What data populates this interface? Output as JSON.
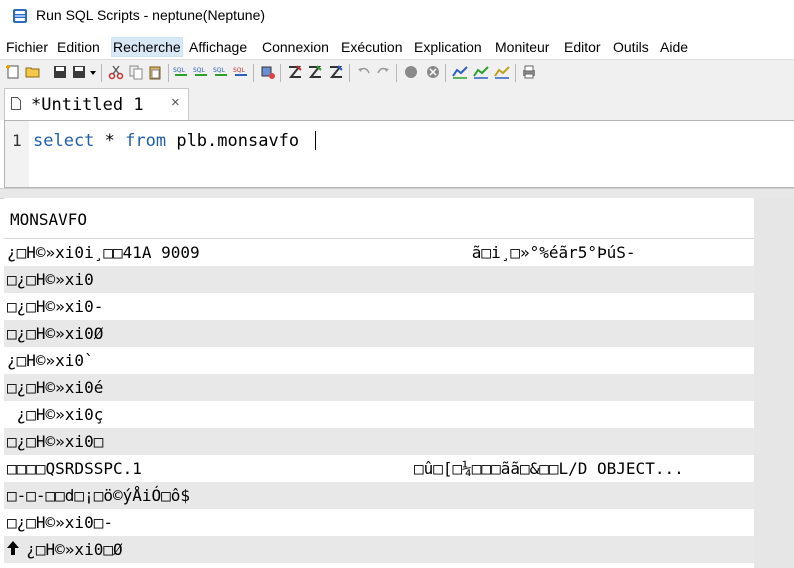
{
  "window": {
    "title": "Run SQL Scripts - neptune(Neptune)"
  },
  "menu": [
    {
      "label": "Fichier"
    },
    {
      "label": "Edition"
    },
    {
      "label": "Recherche",
      "active": true
    },
    {
      "label": "Affichage"
    },
    {
      "label": "Connexion"
    },
    {
      "label": "Exécution"
    },
    {
      "label": "Explication"
    },
    {
      "label": "Moniteur"
    },
    {
      "label": "Editor"
    },
    {
      "label": "Outils"
    },
    {
      "label": "Aide"
    }
  ],
  "toolbar": {
    "buttons": [
      "new-script-icon",
      "open-icon",
      "save-icon",
      "save-dropdown-icon",
      "cut-icon",
      "copy-icon",
      "paste-icon",
      "sql-statement-icon",
      "sql-selected-icon",
      "sql-all-icon",
      "sql-from-cursor-icon",
      "connection-icon",
      "explain-icon",
      "explain-run-icon",
      "explain-stop-icon",
      "undo-icon",
      "redo-icon",
      "stop-icon",
      "cancel-icon",
      "monitor-icon",
      "monitor-run-icon",
      "monitor-stop-icon",
      "print-icon"
    ]
  },
  "tab": {
    "label": "*Untitled 1",
    "close": "×"
  },
  "editor": {
    "line_number": "1",
    "kw_select": "select",
    "star": " * ",
    "kw_from": "from",
    "rest": " plb.monsavfo "
  },
  "results": {
    "column_header": "MONSAVFO",
    "rows": [
      {
        "left": "¿□H©»xi0i¸□□41A 9009",
        "right": "      ã□i¸□»°%éãr5°ÞúS-"
      },
      {
        "left": "□¿□H©»xi0",
        "right": ""
      },
      {
        "left": "□¿□H©»xi0-",
        "right": ""
      },
      {
        "left": "□¿□H©»xi0Ø",
        "right": ""
      },
      {
        "left": "¿□H©»xi0`",
        "right": ""
      },
      {
        "left": "□¿□H©»xi0é",
        "right": ""
      },
      {
        "left": " ¿□H©»xi0ç",
        "right": ""
      },
      {
        "left": "□¿□H©»xi0□",
        "right": ""
      },
      {
        "left": "□□□□QSRDSSPC.1",
        "right": "□û□[□¼□□□ãã□&□□L/D OBJECT..."
      },
      {
        "left": "□-□-□□d□¡□ö©ýÅiÓ□ô$",
        "right": ""
      },
      {
        "left": "□¿□H©»xi0□-",
        "right": ""
      },
      {
        "left": "  ¿□H©»xi0□Ø",
        "right": ""
      }
    ]
  },
  "colors": {
    "keyword": "#1f5fb0",
    "alt_row": "#e8e8e8"
  }
}
